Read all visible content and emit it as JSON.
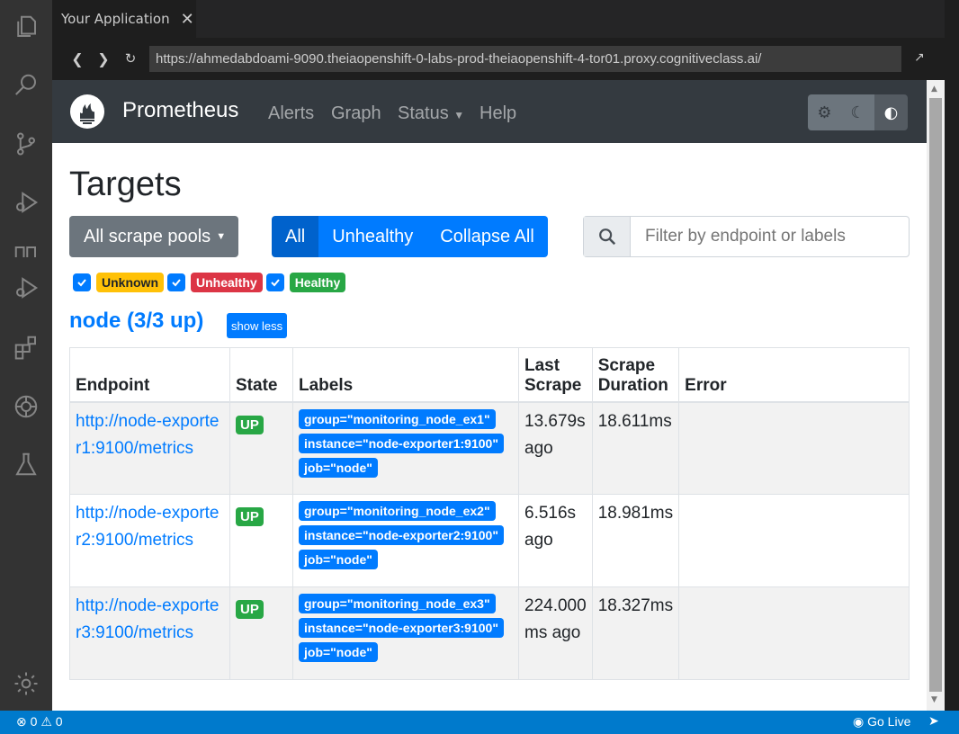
{
  "ide": {
    "tab_title": "Your Application",
    "tab_close": "✕",
    "url": "https://ahmedabdoami-9090.theiaopenshift-0-labs-prod-theiaopenshift-4-tor01.proxy.cognitiveclass.ai/",
    "status_errors": "0",
    "status_warnings": "0",
    "go_live": "Go Live"
  },
  "prom": {
    "brand": "Prometheus",
    "nav": {
      "alerts": "Alerts",
      "graph": "Graph",
      "status": "Status",
      "help": "Help"
    },
    "page_title": "Targets",
    "scrape_pools_btn": "All scrape pools",
    "filter_buttons": {
      "all": "All",
      "unhealthy": "Unhealthy",
      "collapse": "Collapse All"
    },
    "filter_placeholder": "Filter by endpoint or labels",
    "health_filters": {
      "unknown": "Unknown",
      "unhealthy": "Unhealthy",
      "healthy": "Healthy"
    },
    "pool_title": "node (3/3 up)",
    "show_less": "show less",
    "columns": {
      "endpoint": "Endpoint",
      "state": "State",
      "labels": "Labels",
      "last_scrape_1": "Last",
      "last_scrape_2": "Scrape",
      "scrape_duration_1": "Scrape",
      "scrape_duration_2": "Duration",
      "error": "Error"
    },
    "rows": [
      {
        "endpoint": "http://node-exporter1:9100/metrics",
        "state": "UP",
        "label_group": "group=\"monitoring_node_ex1\"",
        "label_instance": "instance=\"node-exporter1:9100\"",
        "label_job": "job=\"node\"",
        "last_scrape": "13.679s ago",
        "duration": "18.611ms",
        "error": ""
      },
      {
        "endpoint": "http://node-exporter2:9100/metrics",
        "state": "UP",
        "label_group": "group=\"monitoring_node_ex2\"",
        "label_instance": "instance=\"node-exporter2:9100\"",
        "label_job": "job=\"node\"",
        "last_scrape": "6.516s ago",
        "duration": "18.981ms",
        "error": ""
      },
      {
        "endpoint": "http://node-exporter3:9100/metrics",
        "state": "UP",
        "label_group": "group=\"monitoring_node_ex3\"",
        "label_instance": "instance=\"node-exporter3:9100\"",
        "label_job": "job=\"node\"",
        "last_scrape": "224.000 ms ago",
        "duration": "18.327ms",
        "error": ""
      }
    ]
  },
  "colors": {
    "primary": "#007bff",
    "success": "#28a745",
    "danger": "#dc3545",
    "warning": "#ffc107",
    "navbar": "#343a40",
    "statusbar": "#007acc"
  },
  "icons": [
    "files-icon",
    "search-icon",
    "source-control-icon",
    "debug-icon",
    "run-icon",
    "extensions-icon",
    "kubernetes-icon",
    "flask-icon",
    "gear-icon"
  ]
}
